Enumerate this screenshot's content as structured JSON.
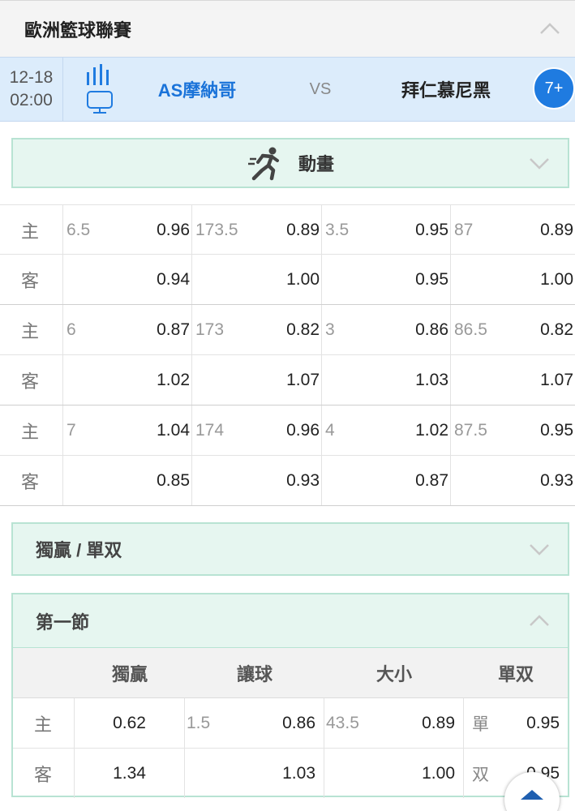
{
  "league": {
    "title": "歐洲籃球聯賽"
  },
  "match": {
    "date": "12-18",
    "time": "02:00",
    "home": "AS摩納哥",
    "vs": "VS",
    "away": "拜仁慕尼黑",
    "more": "7+"
  },
  "animation": {
    "label": "動畫"
  },
  "odds": {
    "groups": [
      {
        "home": {
          "side": "主",
          "cells": [
            [
              "6.5",
              "0.96"
            ],
            [
              "173.5",
              "0.89"
            ],
            [
              "3.5",
              "0.95"
            ],
            [
              "87",
              "0.89"
            ]
          ]
        },
        "away": {
          "side": "客",
          "cells": [
            [
              "",
              "0.94"
            ],
            [
              "",
              "1.00"
            ],
            [
              "",
              "0.95"
            ],
            [
              "",
              "1.00"
            ]
          ]
        }
      },
      {
        "home": {
          "side": "主",
          "cells": [
            [
              "6",
              "0.87"
            ],
            [
              "173",
              "0.82"
            ],
            [
              "3",
              "0.86"
            ],
            [
              "86.5",
              "0.82"
            ]
          ]
        },
        "away": {
          "side": "客",
          "cells": [
            [
              "",
              "1.02"
            ],
            [
              "",
              "1.07"
            ],
            [
              "",
              "1.03"
            ],
            [
              "",
              "1.07"
            ]
          ]
        }
      },
      {
        "home": {
          "side": "主",
          "cells": [
            [
              "7",
              "1.04"
            ],
            [
              "174",
              "0.96"
            ],
            [
              "4",
              "1.02"
            ],
            [
              "87.5",
              "0.95"
            ]
          ]
        },
        "away": {
          "side": "客",
          "cells": [
            [
              "",
              "0.85"
            ],
            [
              "",
              "0.93"
            ],
            [
              "",
              "0.87"
            ],
            [
              "",
              "0.93"
            ]
          ]
        }
      }
    ]
  },
  "odd_even_section": {
    "label": "獨贏 / 單双"
  },
  "first_quarter": {
    "title": "第一節",
    "columns": [
      "獨贏",
      "讓球",
      "大小",
      "單双"
    ],
    "rows": [
      {
        "side": "主",
        "moneyline": "0.62",
        "handicap_line": "1.5",
        "handicap_odds": "0.86",
        "total_line": "43.5",
        "total_odds": "0.89",
        "oe_label": "單",
        "oe_odds": "0.95"
      },
      {
        "side": "客",
        "moneyline": "1.34",
        "handicap_line": "",
        "handicap_odds": "1.03",
        "total_line": "",
        "total_odds": "1.00",
        "oe_label": "双",
        "oe_odds": "0.95"
      }
    ]
  },
  "colors": {
    "accent": "#1f7be0",
    "match_bg": "#dcecfb",
    "section_bg": "#e6f6f0",
    "section_border": "#b8e3d3"
  }
}
